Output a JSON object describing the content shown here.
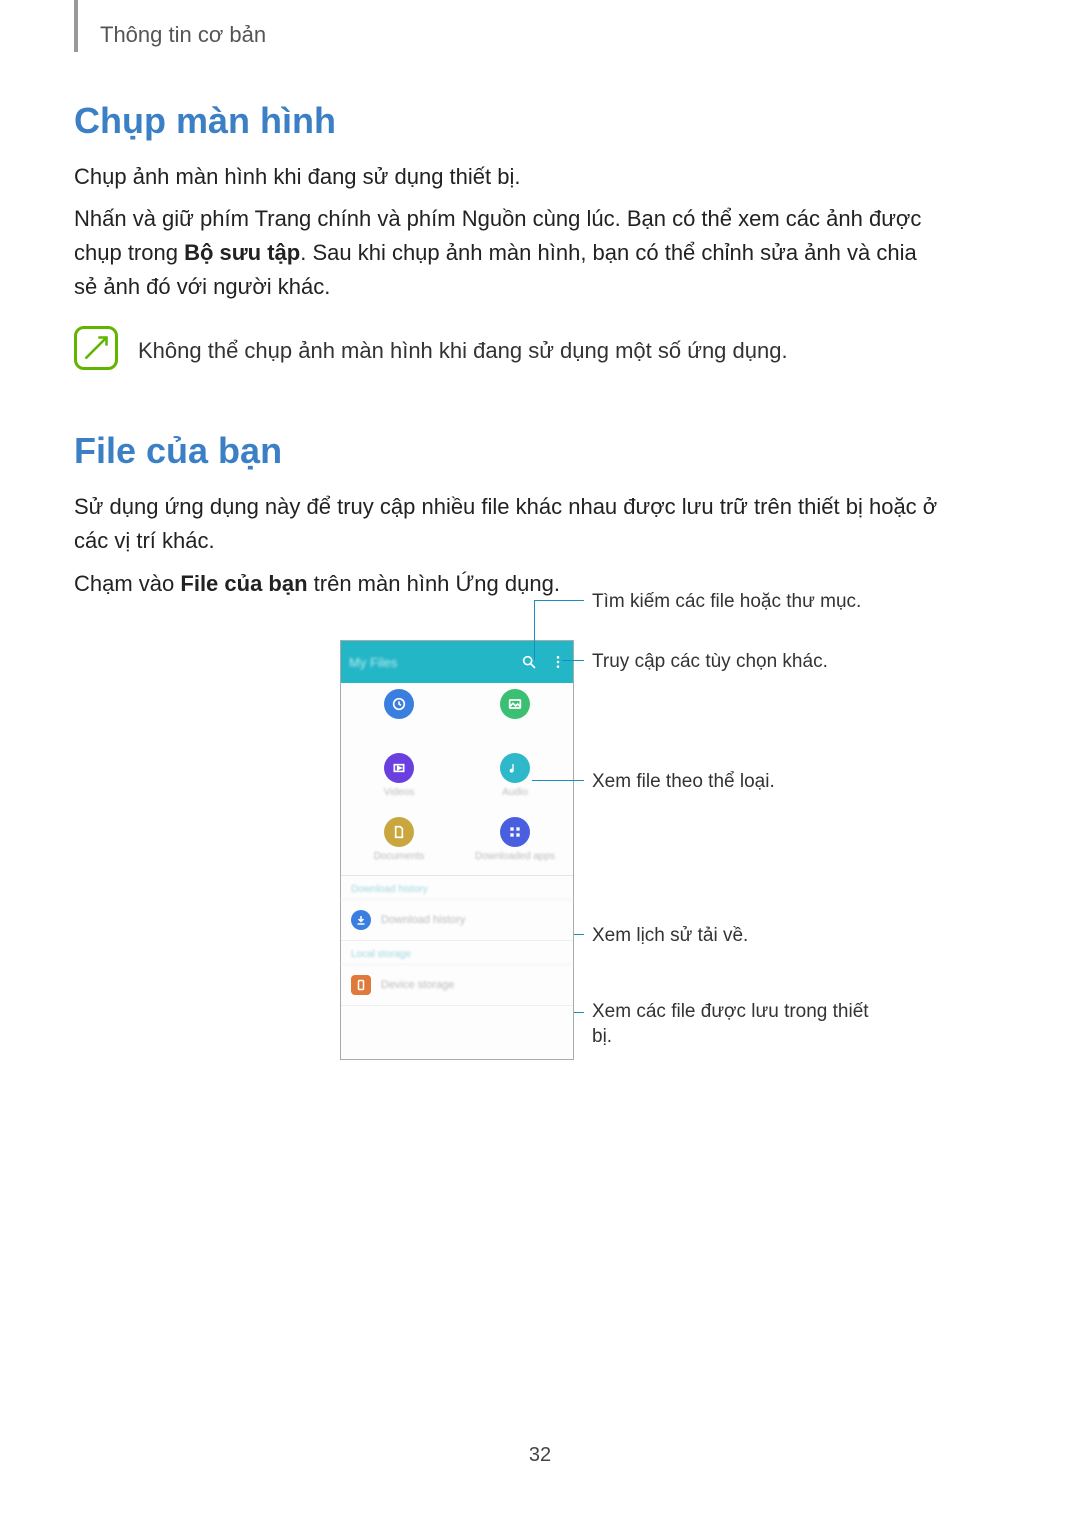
{
  "header": {
    "breadcrumb": "Thông tin cơ bản"
  },
  "section1": {
    "title": "Chụp màn hình",
    "p1": "Chụp ảnh màn hình khi đang sử dụng thiết bị.",
    "p2_a": "Nhấn và giữ phím Trang chính và phím Nguồn cùng lúc. Bạn có thể xem các ảnh được chụp trong ",
    "p2_bold": "Bộ sưu tập",
    "p2_b": ". Sau khi chụp ảnh màn hình, bạn có thể chỉnh sửa ảnh và chia sẻ ảnh đó với người khác.",
    "note": "Không thể chụp ảnh màn hình khi đang sử dụng một số ứng dụng."
  },
  "section2": {
    "title": "File của bạn",
    "p1": "Sử dụng ứng dụng này để truy cập nhiều file khác nhau được lưu trữ trên thiết bị hoặc ở các vị trí khác.",
    "p2_a": "Chạm vào ",
    "p2_bold": "File của bạn",
    "p2_b": " trên màn hình Ứng dụng."
  },
  "callouts": {
    "search": "Tìm kiếm các file hoặc thư mục.",
    "more": "Truy cập các tùy chọn khác.",
    "category": "Xem file theo thể loại.",
    "download": "Xem lịch sử tải về.",
    "device": "Xem các file được lưu trong thiết bị."
  },
  "phone": {
    "title": "My Files",
    "cat1": "Videos",
    "cat2": "Audio",
    "cat3": "Documents",
    "cat4": "Downloaded apps",
    "sec_dl": "Download history",
    "row_dl": "Download history",
    "sec_local": "Local storage",
    "row_dev": "Device storage"
  },
  "page": "32"
}
